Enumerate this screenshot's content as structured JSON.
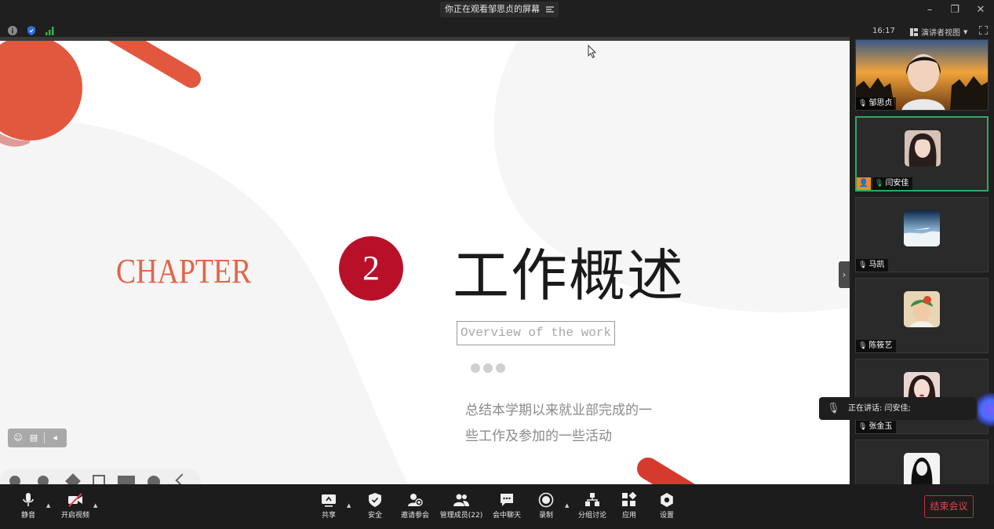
{
  "titlebar": {
    "sharing_text": "你正在观看邹思贞的屏幕",
    "time": "16:17",
    "view_mode": "演讲者视图"
  },
  "slide": {
    "chapter_label": "CHAPTER",
    "chapter_number": "2",
    "title": "工作概述",
    "subtitle": "Overview of the work",
    "body_line1": "总结本学期以来就业部完成的一",
    "body_line2": "些工作及参加的一些活动"
  },
  "participants": [
    {
      "name": "邹思贞",
      "active": false
    },
    {
      "name": "闫安佳",
      "active": true
    },
    {
      "name": "马凯",
      "active": false
    },
    {
      "name": "陈筱艺",
      "active": false
    },
    {
      "name": "张金玉",
      "active": false
    }
  ],
  "speaking": {
    "text": "正在讲话: 闫安佳;"
  },
  "toolbar": {
    "mute": "静音",
    "video": "开启视频",
    "share": "共享",
    "security": "安全",
    "invite": "邀请参会",
    "members": "管理成员(22)",
    "chat": "会中聊天",
    "record": "录制",
    "breakout": "分组讨论",
    "apps": "应用",
    "settings": "设置",
    "end": "结束会议"
  },
  "colors": {
    "accent_red": "#b9102a",
    "chapter_orange": "#e2654a",
    "active_green": "#2ea864",
    "end_red": "#e2434f"
  }
}
